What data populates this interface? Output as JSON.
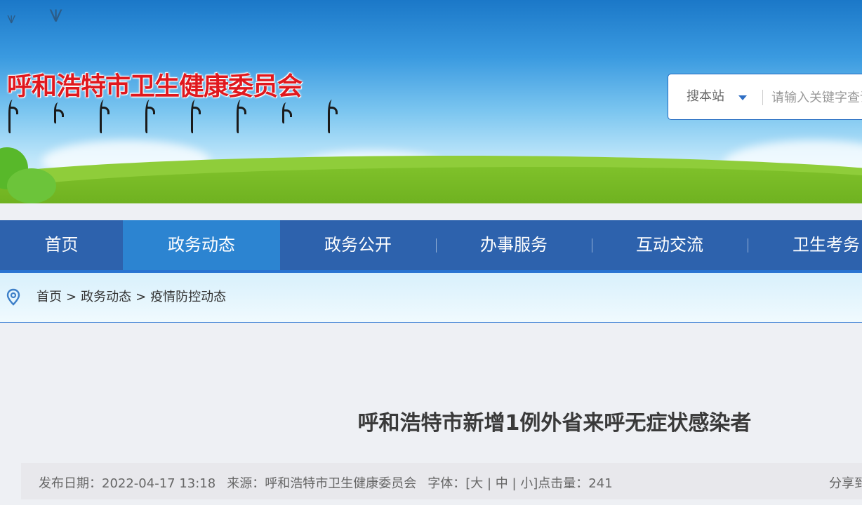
{
  "header": {
    "site_title": "呼和浩特市卫生健康委员会"
  },
  "search": {
    "scope_label": "搜本站",
    "placeholder": "请输入关键字查询"
  },
  "nav": {
    "items": [
      {
        "label": "首页"
      },
      {
        "label": "政务动态"
      },
      {
        "label": "政务公开"
      },
      {
        "label": "办事服务"
      },
      {
        "label": "互动交流"
      },
      {
        "label": "卫生考务"
      }
    ],
    "active_index": 1
  },
  "breadcrumb": {
    "items": [
      "首页",
      "政务动态",
      "疫情防控动态"
    ],
    "separator": ">"
  },
  "article": {
    "title": "呼和浩特市新增1例外省来呼无症状感染者",
    "meta": {
      "date_label": "发布日期：",
      "date": "2022-04-17 13:18",
      "source_label": "来源：",
      "source": "呼和浩特市卫生健康委员会",
      "font_label": "字体：",
      "font_open": "[",
      "font_large": "大",
      "font_sep": " | ",
      "font_medium": "中",
      "font_small": "小",
      "font_close": "]",
      "clicks_label": "点击量：",
      "clicks": "241",
      "share_label": "分享到："
    }
  },
  "colors": {
    "nav_bg": "#2d62ad",
    "nav_active": "#2c84d1",
    "title_red": "#e0181e"
  }
}
